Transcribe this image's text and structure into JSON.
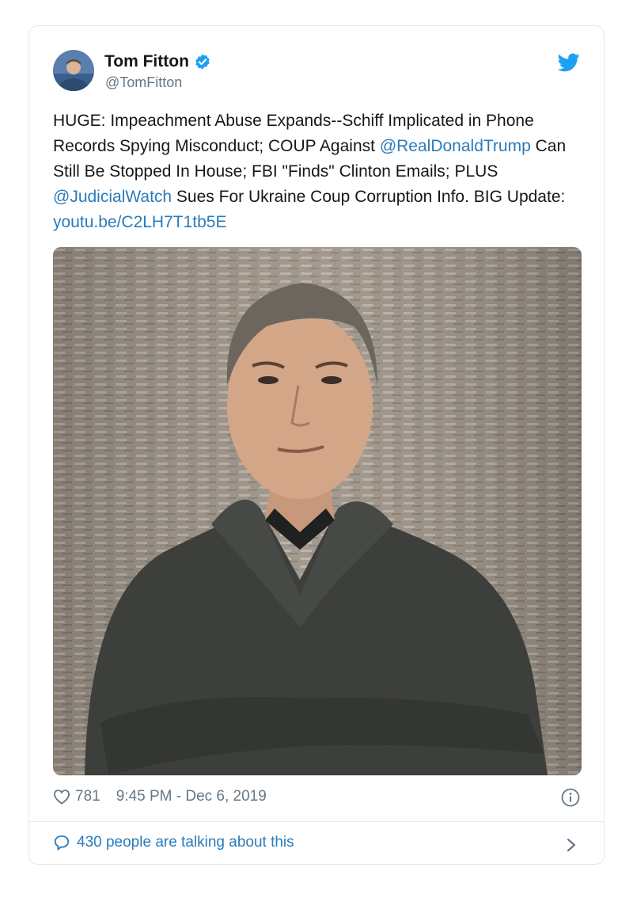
{
  "author": {
    "name": "Tom Fitton",
    "handle": "@TomFitton"
  },
  "tweet": {
    "text_1": "HUGE: Impeachment Abuse Expands--Schiff Implicated in Phone Records Spying Misconduct; COUP Against ",
    "mention_1": "@RealDonaldTrump",
    "text_2": " Can Still Be Stopped In House; FBI \"Finds\" Clinton Emails; PLUS ",
    "mention_2": "@JudicialWatch",
    "text_3": " Sues For Ukraine Coup Corruption Info. BIG Update: ",
    "link": "youtu.be/C2LH7T1tb5E"
  },
  "footer": {
    "likes": "781",
    "timestamp": "9:45 PM - Dec 6, 2019",
    "talking": "430 people are talking about this"
  },
  "icons": {
    "verified": "verified-badge-icon",
    "twitter": "twitter-bird-icon",
    "like": "heart-icon",
    "info": "info-icon",
    "reply": "speech-bubble-icon",
    "more": "chevron-right-icon"
  },
  "colors": {
    "link": "#2b7bb9",
    "twitter_blue": "#1da1f2",
    "secondary_text": "#657786",
    "border": "#e1e8ed"
  }
}
